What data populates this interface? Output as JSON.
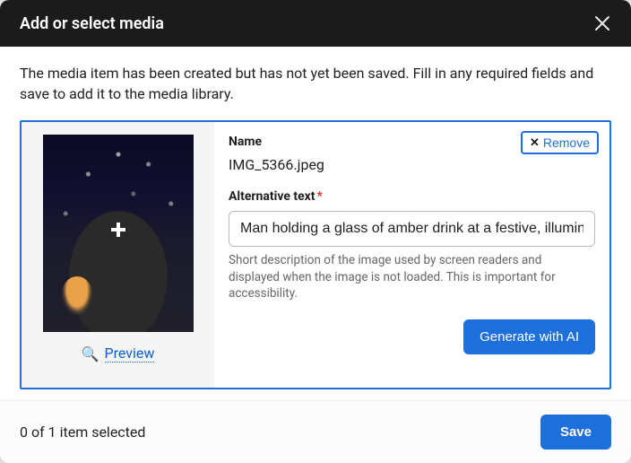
{
  "header": {
    "title": "Add or select media"
  },
  "notice": "The media item has been created but has not yet been saved. Fill in any required fields and save to add it to the media library.",
  "media": {
    "preview_label": "Preview",
    "remove_label": "Remove",
    "name_label": "Name",
    "name_value": "IMG_5366.jpeg",
    "alt_label": "Alternative text",
    "alt_value": "Man holding a glass of amber drink at a festive, illumina",
    "alt_help": "Short description of the image used by screen readers and displayed when the image is not loaded. This is important for accessibility.",
    "generate_label": "Generate with AI"
  },
  "footer": {
    "selection": "0 of 1 item selected",
    "save_label": "Save"
  }
}
